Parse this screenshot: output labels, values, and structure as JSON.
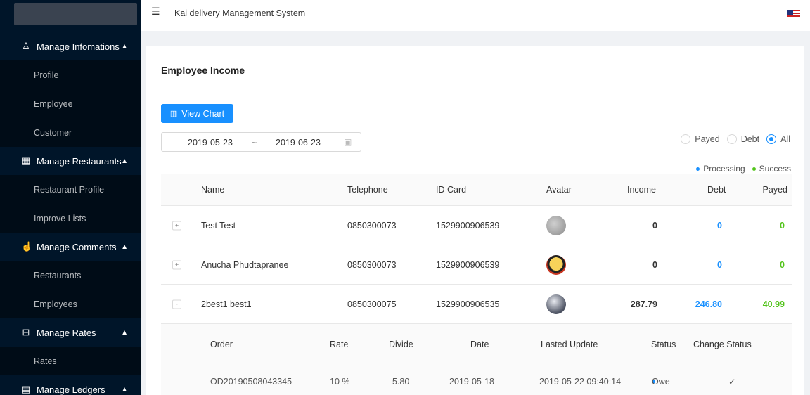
{
  "header": {
    "title": "Kai delivery Management System"
  },
  "sidebar": {
    "groups": [
      {
        "label": "Manage Infomations",
        "icon": "user-icon",
        "items": [
          "Profile",
          "Employee",
          "Customer"
        ]
      },
      {
        "label": "Manage Restaurants",
        "icon": "restaurant-icon",
        "items": [
          "Restaurant Profile",
          "Improve Lists"
        ]
      },
      {
        "label": "Manage Comments",
        "icon": "thumbs-up-icon",
        "items": [
          "Restaurants",
          "Employees"
        ]
      },
      {
        "label": "Manage Rates",
        "icon": "rates-icon",
        "items": [
          "Rates"
        ]
      },
      {
        "label": "Manage Ledgers",
        "icon": "ledger-icon",
        "items": []
      }
    ]
  },
  "page": {
    "title": "Employee Income",
    "view_chart_label": "View Chart",
    "date_start": "2019-05-23",
    "date_sep": "~",
    "date_end": "2019-06-23",
    "filter": {
      "options": [
        "Payed",
        "Debt",
        "All"
      ],
      "selected": "All"
    },
    "legend": {
      "processing": "Processing",
      "success": "Success",
      "processing_color": "#1890ff",
      "success_color": "#52c41a"
    }
  },
  "table": {
    "columns": [
      "Name",
      "Telephone",
      "ID Card",
      "Avatar",
      "Income",
      "Debt",
      "Payed"
    ],
    "rows": [
      {
        "expander": "+",
        "name": "Test Test",
        "telephone": "0850300073",
        "id_card": "1529900906539",
        "income": "0",
        "debt": "0",
        "payed": "0"
      },
      {
        "expander": "+",
        "name": "Anucha Phudtapranee",
        "telephone": "0850300073",
        "id_card": "1529900906539",
        "income": "0",
        "debt": "0",
        "payed": "0"
      },
      {
        "expander": "-",
        "name": "2best1 best1",
        "telephone": "0850300075",
        "id_card": "1529900906535",
        "income": "287.79",
        "debt": "246.80",
        "payed": "40.99"
      }
    ],
    "nested": {
      "columns": [
        "Order",
        "Rate",
        "Divide",
        "Date",
        "Lasted Update",
        "Status",
        "Change Status"
      ],
      "rows": [
        {
          "order": "OD20190508043345",
          "rate": "10 %",
          "divide": "5.80",
          "date": "2019-05-18",
          "updated": "2019-05-22 09:40:14",
          "status": "Owe",
          "change": "✓"
        }
      ]
    }
  }
}
